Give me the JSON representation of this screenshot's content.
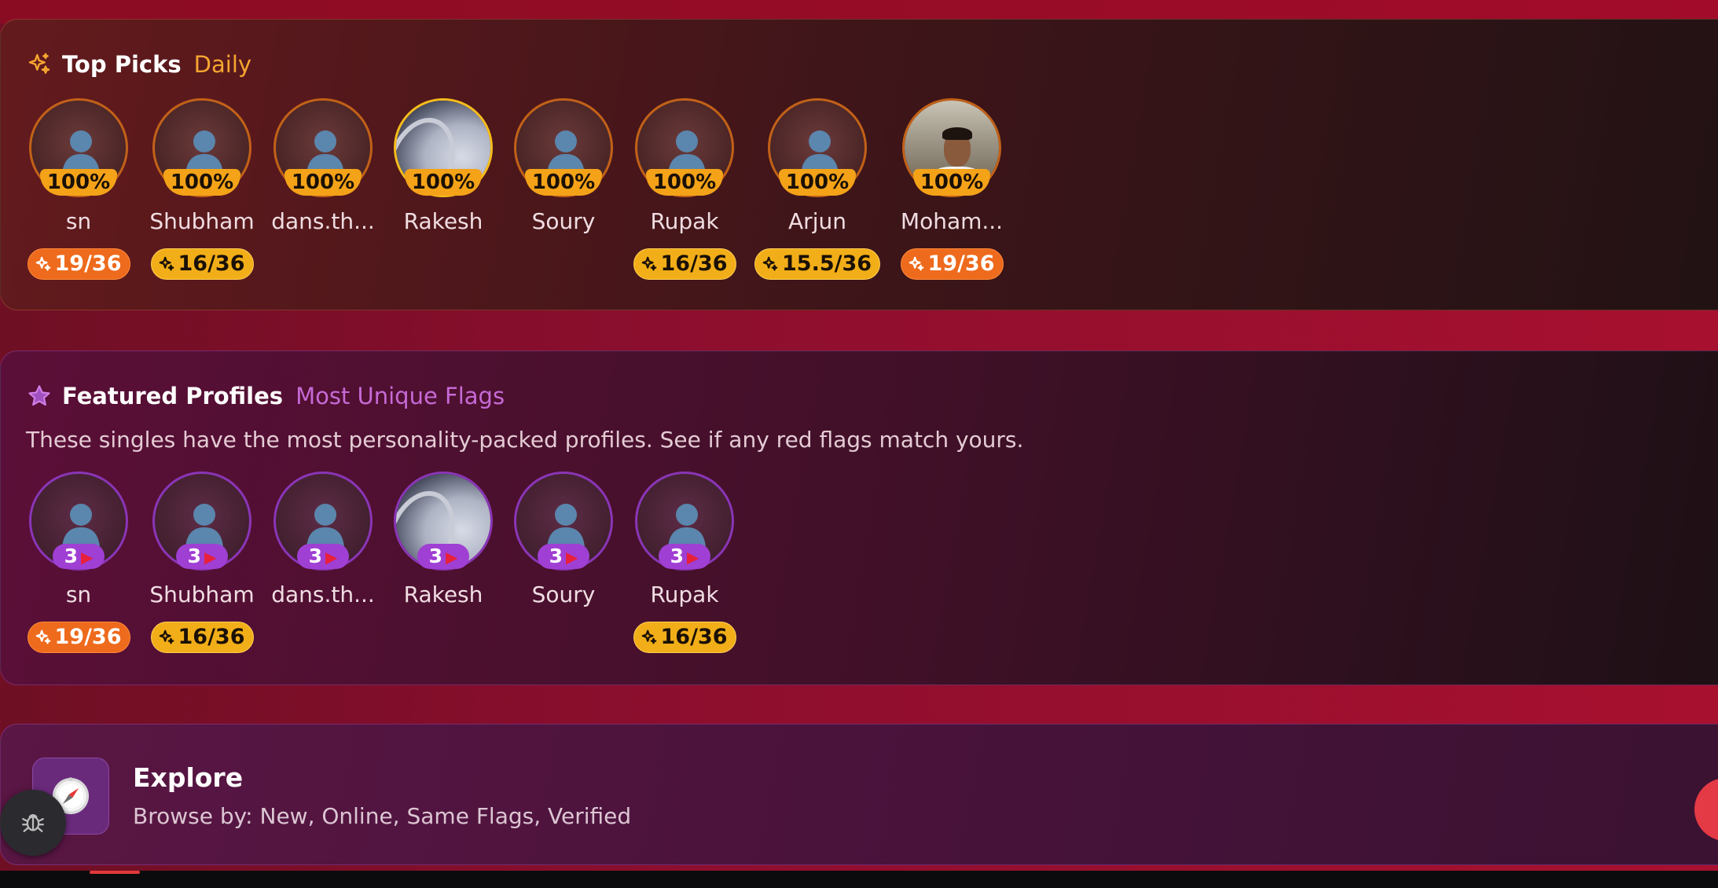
{
  "colors": {
    "accent_orange": "#f6a630",
    "accent_purple": "#c66ad6",
    "score_orange": "#ee6a1c",
    "score_gold": "#f2ae18",
    "flag_purple": "#a03fd4"
  },
  "top_picks": {
    "title": "Top Picks",
    "subtitle": "Daily",
    "icon": "sparkle-icon",
    "profiles": [
      {
        "name": "sn",
        "match": "100%",
        "score": "19/36",
        "score_style": "orange",
        "photo": "placeholder"
      },
      {
        "name": "Shubham",
        "match": "100%",
        "score": "16/36",
        "score_style": "gold",
        "photo": "placeholder"
      },
      {
        "name": "dans.th...",
        "match": "100%",
        "score": "",
        "score_style": "",
        "photo": "placeholder"
      },
      {
        "name": "Rakesh",
        "match": "100%",
        "score": "",
        "score_style": "",
        "photo": "car"
      },
      {
        "name": "Soury",
        "match": "100%",
        "score": "",
        "score_style": "",
        "photo": "placeholder"
      },
      {
        "name": "Rupak",
        "match": "100%",
        "score": "16/36",
        "score_style": "gold",
        "photo": "placeholder"
      },
      {
        "name": "Arjun",
        "match": "100%",
        "score": "15.5/36",
        "score_style": "gold",
        "photo": "placeholder"
      },
      {
        "name": "Moham...",
        "match": "100%",
        "score": "19/36",
        "score_style": "orange",
        "photo": "man"
      }
    ]
  },
  "featured": {
    "title": "Featured Profiles",
    "subtitle": "Most Unique Flags",
    "icon": "star-icon",
    "description": "These singles have the most personality-packed profiles. See if any red flags match yours.",
    "profiles": [
      {
        "name": "sn",
        "flags": "3",
        "score": "19/36",
        "score_style": "orange",
        "photo": "placeholder"
      },
      {
        "name": "Shubham",
        "flags": "3",
        "score": "16/36",
        "score_style": "gold",
        "photo": "placeholder"
      },
      {
        "name": "dans.th...",
        "flags": "3",
        "score": "",
        "score_style": "",
        "photo": "placeholder"
      },
      {
        "name": "Rakesh",
        "flags": "3",
        "score": "",
        "score_style": "",
        "photo": "car"
      },
      {
        "name": "Soury",
        "flags": "3",
        "score": "",
        "score_style": "",
        "photo": "placeholder"
      },
      {
        "name": "Rupak",
        "flags": "3",
        "score": "16/36",
        "score_style": "gold",
        "photo": "placeholder"
      }
    ]
  },
  "explore": {
    "title": "Explore",
    "subtitle": "Browse by: New, Online, Same Flags, Verified",
    "icon": "compass-icon"
  },
  "debug_button": {
    "icon": "bug-icon"
  }
}
